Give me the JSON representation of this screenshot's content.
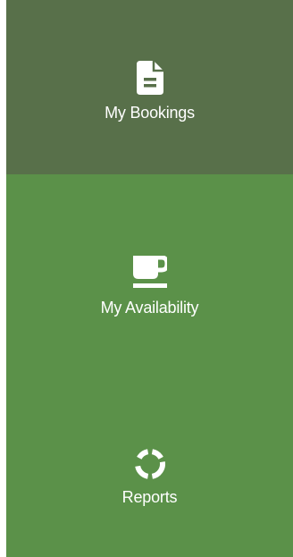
{
  "sidebar": {
    "items": [
      {
        "label": "My Bookings",
        "icon": "document-icon",
        "active": true
      },
      {
        "label": "My Availability",
        "icon": "coffee-cup-icon",
        "active": false
      },
      {
        "label": "Reports",
        "icon": "donut-chart-icon",
        "active": false
      }
    ]
  },
  "colors": {
    "sidebar_background": "#5b9149",
    "active_item_background": "#58704a",
    "text": "#ffffff",
    "icon": "#ffffff"
  }
}
